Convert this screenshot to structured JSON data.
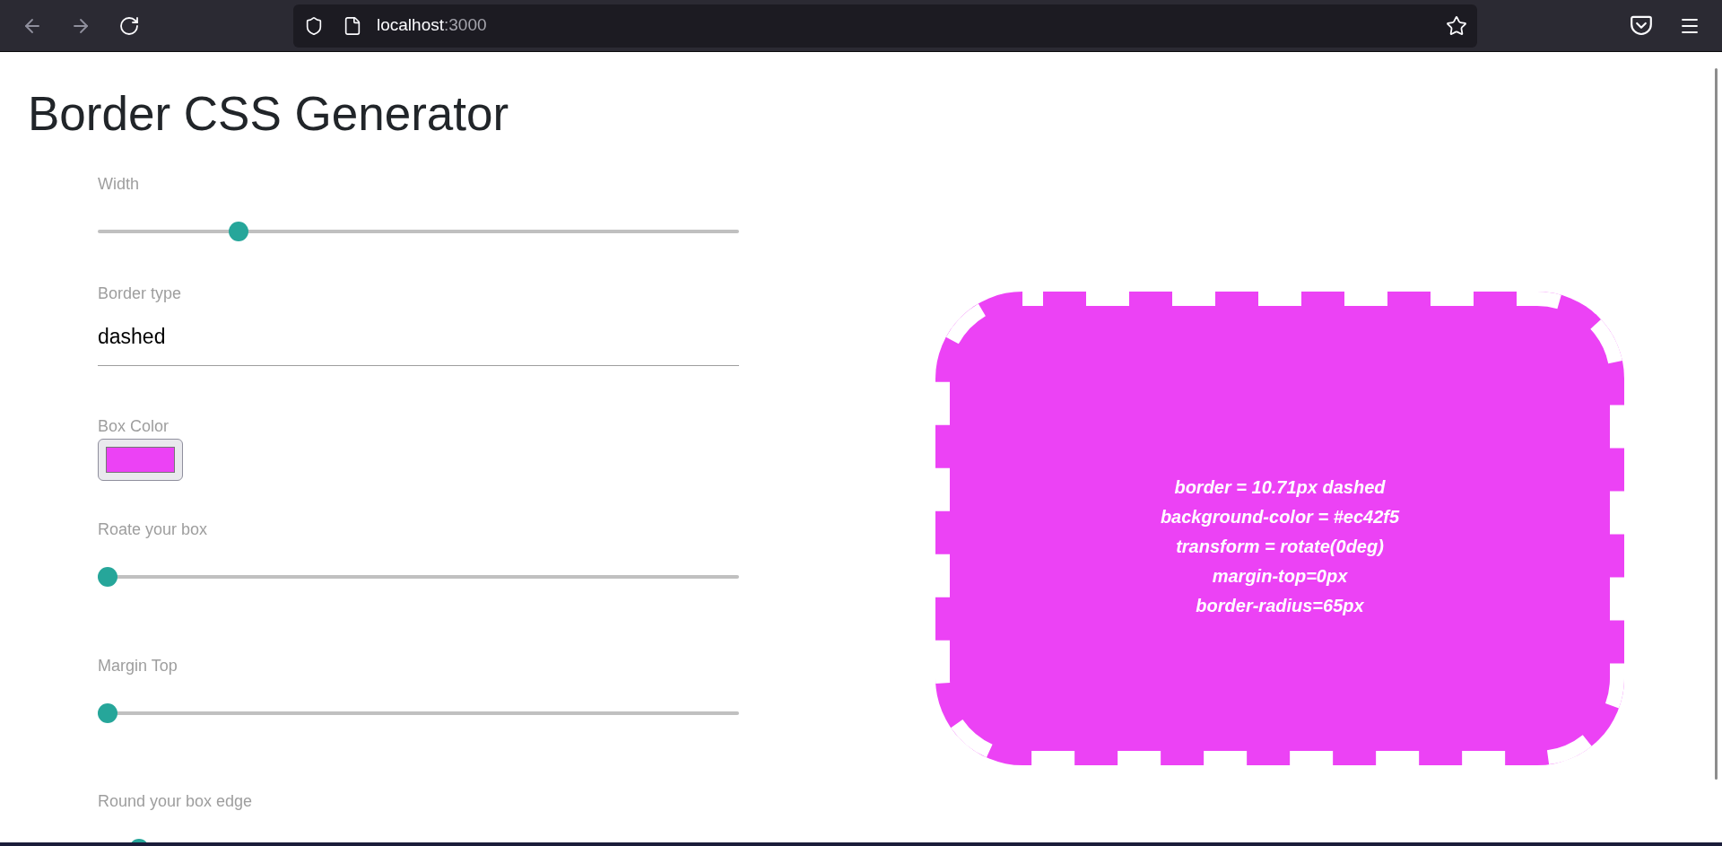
{
  "browser": {
    "nav": [
      {
        "kind": "back",
        "disabled": true
      },
      {
        "kind": "forward",
        "disabled": true
      },
      {
        "kind": "reload",
        "disabled": false
      }
    ],
    "address": {
      "host": "localhost",
      "port": ":3000"
    }
  },
  "page": {
    "title": "Border CSS Generator"
  },
  "controls": [
    {
      "kind": "slider",
      "label": "Width",
      "level": 0.21
    },
    {
      "kind": "text",
      "label": "Border type",
      "value": "dashed"
    },
    {
      "kind": "color",
      "label": "Box Color",
      "color": "#ec42f5"
    },
    {
      "kind": "slider",
      "label": "Roate your box",
      "level": 0
    },
    {
      "kind": "slider",
      "label": "Margin Top",
      "level": 0
    },
    {
      "kind": "slider",
      "label": "Round your box edge",
      "level": 0.05
    }
  ],
  "preview": {
    "lines": [
      "border = 10.71px dashed",
      "background-color = #ec42f5",
      "transform = rotate(0deg)",
      "margin-top=0px",
      "border-radius=65px"
    ]
  }
}
